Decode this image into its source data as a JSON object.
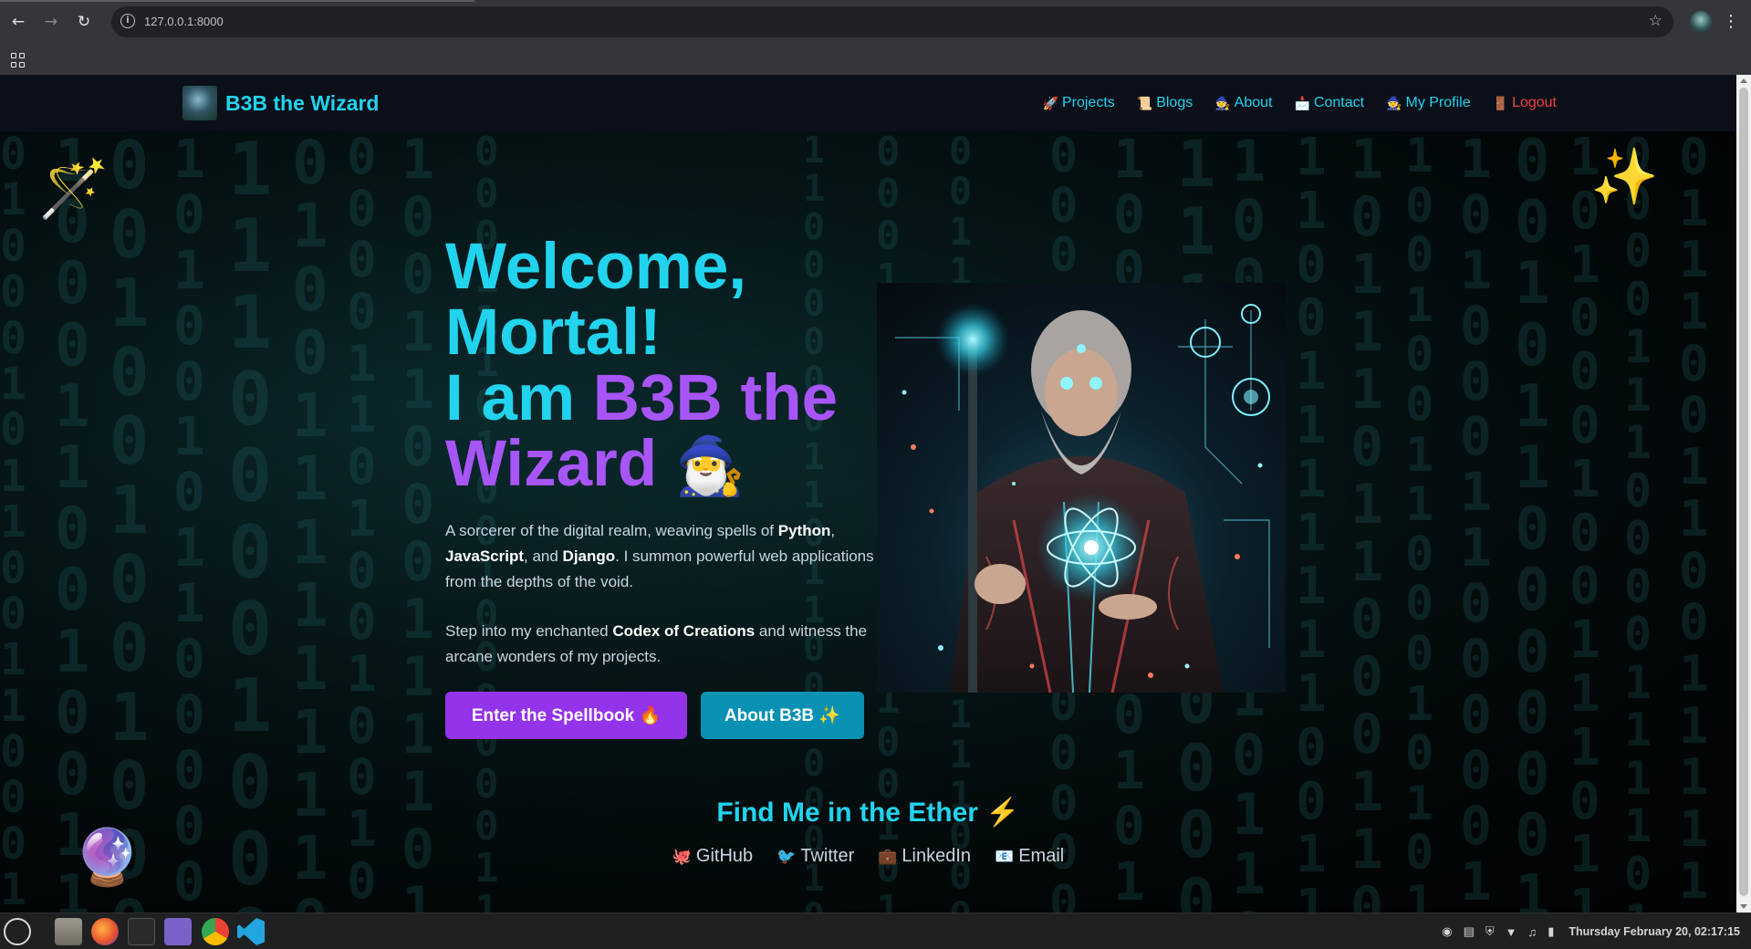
{
  "browser": {
    "url": "127.0.0.1:8000",
    "back_icon": "arrow-left-icon",
    "forward_icon": "arrow-right-icon",
    "reload_icon": "reload-icon",
    "bookmark_icon": "star-icon",
    "menu_icon": "kebab-menu-icon"
  },
  "site": {
    "brand": "B3B the Wizard",
    "nav": [
      {
        "icon": "🚀",
        "label": "Projects"
      },
      {
        "icon": "📜",
        "label": "Blogs"
      },
      {
        "icon": "🧙",
        "label": "About"
      },
      {
        "icon": "📩",
        "label": "Contact"
      },
      {
        "icon": "🧙",
        "label": "My Profile"
      },
      {
        "icon": "🚪",
        "label": "Logout"
      }
    ]
  },
  "hero": {
    "title_line1": "Welcome,",
    "title_line2": "Mortal!",
    "title_line3_prefix": "I am ",
    "title_line3_name": "B3B the",
    "title_line4_name": "Wizard",
    "title_emoji": "🧙‍♂️",
    "desc1": {
      "p1": "A sorcerer of the digital realm, weaving spells of ",
      "b1": "Python",
      "p2": ", ",
      "b2": "JavaScript",
      "p3": ", and ",
      "b3": "Django",
      "p4": ". I summon powerful web applications from the depths of the void."
    },
    "desc2": {
      "p1": "Step into my enchanted ",
      "b1": "Codex of Creations",
      "p2": " and witness the arcane wonders of my projects."
    },
    "primary_button": "Enter the Spellbook 🔥",
    "secondary_button": "About B3B ✨"
  },
  "decor": {
    "wand": "🪄",
    "stars": "✨",
    "crystal_ball": "🔮"
  },
  "socials": {
    "title": "Find Me in the Ether ⚡",
    "links": [
      {
        "icon": "🐙",
        "label": "GitHub"
      },
      {
        "icon": "🐦",
        "label": "Twitter"
      },
      {
        "icon": "💼",
        "label": "LinkedIn"
      },
      {
        "icon": "📧",
        "label": "Email"
      }
    ]
  },
  "taskbar": {
    "clock": "Thursday February 20, 02:17:15"
  },
  "colors": {
    "accent_cyan": "#22d3ee",
    "accent_purple": "#a855f7",
    "button_purple": "#9333ea",
    "button_cyan": "#0891b2",
    "logout_red": "#ef4444"
  }
}
